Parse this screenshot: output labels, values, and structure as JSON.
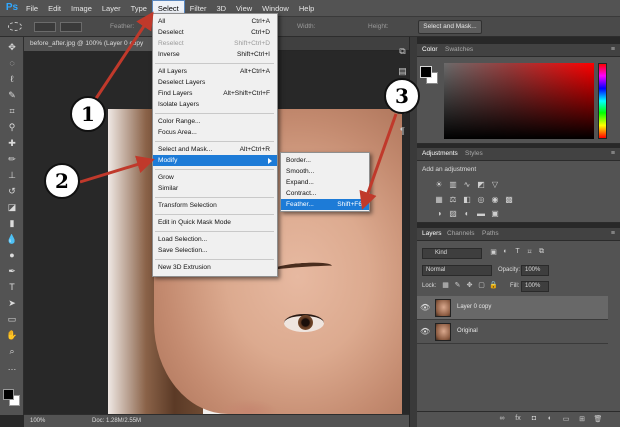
{
  "app": {
    "logo": "Ps"
  },
  "menubar": {
    "items": [
      "File",
      "Edit",
      "Image",
      "Layer",
      "Type",
      "Select",
      "Filter",
      "3D",
      "View",
      "Window",
      "Help"
    ],
    "active_index": 5
  },
  "options_bar": {
    "feather_label": "Feather:",
    "width_label": "Width:",
    "height_label": "Height:",
    "select_mask_button": "Select and Mask..."
  },
  "document": {
    "tab_title": "before_after.jpg @ 100% (Layer 0 copy",
    "zoom": "100%",
    "doc_size": "Doc: 1.28M/2.55M"
  },
  "select_menu": {
    "items": [
      {
        "label": "All",
        "shortcut": "Ctrl+A",
        "disabled": false
      },
      {
        "label": "Deselect",
        "shortcut": "Ctrl+D",
        "disabled": false
      },
      {
        "label": "Reselect",
        "shortcut": "Shift+Ctrl+D",
        "disabled": true
      },
      {
        "label": "Inverse",
        "shortcut": "Shift+Ctrl+I",
        "disabled": false
      },
      {
        "label": "All Layers",
        "shortcut": "Alt+Ctrl+A",
        "disabled": false
      },
      {
        "label": "Deselect Layers",
        "shortcut": "",
        "disabled": false
      },
      {
        "label": "Find Layers",
        "shortcut": "Alt+Shift+Ctrl+F",
        "disabled": false
      },
      {
        "label": "Isolate Layers",
        "shortcut": "",
        "disabled": false
      },
      {
        "label": "Color Range...",
        "shortcut": "",
        "disabled": false
      },
      {
        "label": "Focus Area...",
        "shortcut": "",
        "disabled": false
      },
      {
        "label": "Select and Mask...",
        "shortcut": "Alt+Ctrl+R",
        "disabled": false
      },
      {
        "label": "Modify",
        "shortcut": "",
        "disabled": false
      },
      {
        "label": "Grow",
        "shortcut": "",
        "disabled": false
      },
      {
        "label": "Similar",
        "shortcut": "",
        "disabled": false
      },
      {
        "label": "Transform Selection",
        "shortcut": "",
        "disabled": false
      },
      {
        "label": "Edit in Quick Mask Mode",
        "shortcut": "",
        "disabled": false
      },
      {
        "label": "Load Selection...",
        "shortcut": "",
        "disabled": false
      },
      {
        "label": "Save Selection...",
        "shortcut": "",
        "disabled": false
      },
      {
        "label": "New 3D Extrusion",
        "shortcut": "",
        "disabled": false
      }
    ],
    "highlighted": "Modify"
  },
  "modify_submenu": {
    "items": [
      {
        "label": "Border...",
        "shortcut": ""
      },
      {
        "label": "Smooth...",
        "shortcut": ""
      },
      {
        "label": "Expand...",
        "shortcut": ""
      },
      {
        "label": "Contract...",
        "shortcut": ""
      },
      {
        "label": "Feather...",
        "shortcut": "Shift+F6"
      }
    ],
    "highlighted": "Feather..."
  },
  "callouts": [
    "1",
    "2",
    "3"
  ],
  "color_panel": {
    "tabs": [
      "Color",
      "Swatches"
    ],
    "active": "Color"
  },
  "adjustments_panel": {
    "tabs": [
      "Adjustments",
      "Styles"
    ],
    "active": "Adjustments",
    "title": "Add an adjustment"
  },
  "layers_panel": {
    "tabs": [
      "Layers",
      "Channels",
      "Paths"
    ],
    "active": "Layers",
    "kind_filter": "Kind",
    "blend_mode": "Normal",
    "opacity_label": "Opacity:",
    "opacity_value": "100%",
    "lock_label": "Lock:",
    "fill_label": "Fill:",
    "fill_value": "100%",
    "layers": [
      {
        "name": "Layer 0 copy",
        "selected": true
      },
      {
        "name": "Original",
        "selected": false
      }
    ]
  },
  "colors": {
    "menu_highlight": "#1d7bd7",
    "arrow": "#c0392b",
    "panel_bg": "#535353"
  }
}
